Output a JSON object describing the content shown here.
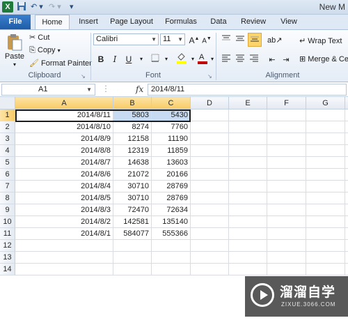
{
  "titlebar": {
    "title": "New M",
    "undo_icon": "undo-icon",
    "redo_icon": "redo-icon",
    "save_icon": "save-icon"
  },
  "tabs": [
    "File",
    "Home",
    "Insert",
    "Page Layout",
    "Formulas",
    "Data",
    "Review",
    "View"
  ],
  "ribbon": {
    "clipboard": {
      "paste": "Paste",
      "cut": "Cut",
      "copy": "Copy",
      "format_painter": "Format Painter",
      "label": "Clipboard"
    },
    "font": {
      "name": "Calibri",
      "size": "11",
      "bold": "B",
      "italic": "I",
      "underline": "U",
      "grow": "A",
      "shrink": "A",
      "label": "Font",
      "font_color": "#c00000",
      "fill_color": "#ffff00"
    },
    "alignment": {
      "wrap_text": "Wrap Text",
      "merge": "Merge & Ce",
      "label": "Alignment"
    }
  },
  "formula_bar": {
    "name_box": "A1",
    "fx": "fx",
    "value": "2014/8/11"
  },
  "columns": [
    "A",
    "B",
    "C",
    "D",
    "E",
    "F",
    "G"
  ],
  "rows": [
    {
      "num": "1",
      "a": "2014/8/11",
      "b": "5803",
      "c": "5430"
    },
    {
      "num": "2",
      "a": "2014/8/10",
      "b": "8274",
      "c": "7760"
    },
    {
      "num": "3",
      "a": "2014/8/9",
      "b": "12158",
      "c": "11190"
    },
    {
      "num": "4",
      "a": "2014/8/8",
      "b": "12319",
      "c": "11859"
    },
    {
      "num": "5",
      "a": "2014/8/7",
      "b": "14638",
      "c": "13603"
    },
    {
      "num": "6",
      "a": "2014/8/6",
      "b": "21072",
      "c": "20166"
    },
    {
      "num": "7",
      "a": "2014/8/4",
      "b": "30710",
      "c": "28769"
    },
    {
      "num": "8",
      "a": "2014/8/5",
      "b": "30710",
      "c": "28769"
    },
    {
      "num": "9",
      "a": "2014/8/3",
      "b": "72470",
      "c": "72634"
    },
    {
      "num": "10",
      "a": "2014/8/2",
      "b": "142581",
      "c": "135140"
    },
    {
      "num": "11",
      "a": "2014/8/1",
      "b": "584077",
      "c": "555366"
    },
    {
      "num": "12",
      "a": "",
      "b": "",
      "c": ""
    },
    {
      "num": "13",
      "a": "",
      "b": "",
      "c": ""
    },
    {
      "num": "14",
      "a": "",
      "b": "",
      "c": ""
    }
  ],
  "watermark": {
    "title": "溜溜自学",
    "url": "ZIXUE.3066.COM"
  }
}
